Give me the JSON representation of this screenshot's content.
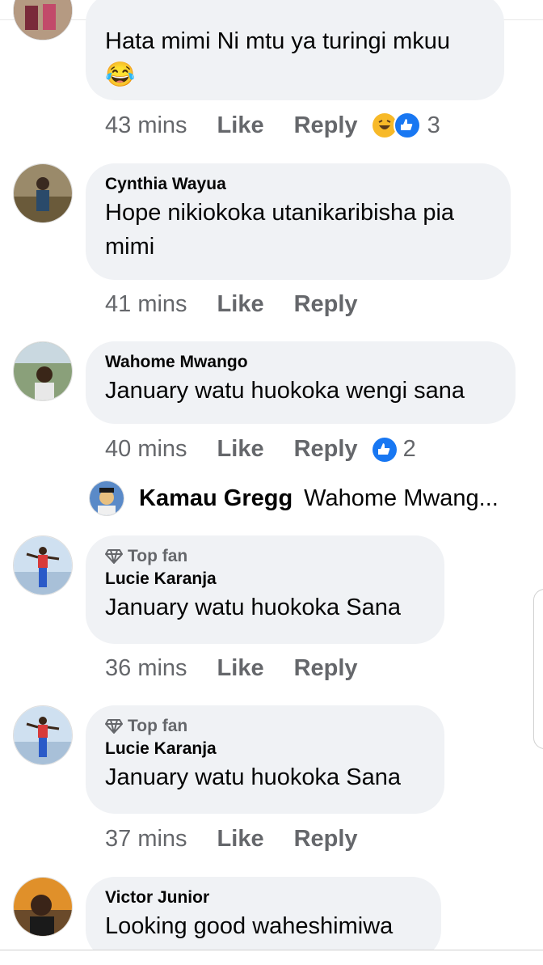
{
  "comments": [
    {
      "name": "",
      "text": "Hata mimi Ni mtu ya turingi mkuu",
      "emoji": "😂",
      "time": "43 mins",
      "like": "Like",
      "reply": "Reply",
      "reactions": "3"
    },
    {
      "name": "Cynthia Wayua",
      "text": "Hope nikiokoka  utanikaribisha pia mimi",
      "time": "41 mins",
      "like": "Like",
      "reply": "Reply"
    },
    {
      "name": "Wahome Mwango",
      "text": "January watu huokoka wengi sana",
      "time": "40 mins",
      "like": "Like",
      "reply": "Reply",
      "reactions": "2"
    },
    {
      "badge": "Top fan",
      "name": "Lucie Karanja",
      "text": "January watu huokoka Sana",
      "time": "36 mins",
      "like": "Like",
      "reply": "Reply"
    },
    {
      "badge": "Top fan",
      "name": "Lucie Karanja",
      "text": "January watu huokoka Sana",
      "time": "37 mins",
      "like": "Like",
      "reply": "Reply"
    },
    {
      "name": "Victor Junior",
      "text": "Looking good waheshimiwa"
    }
  ],
  "reply_preview": {
    "name": "Kamau Gregg",
    "text": "Wahome Mwang..."
  },
  "colors": {
    "bubble": "#f0f2f5",
    "like_blue": "#1877f2",
    "haha_yellow": "#f7b928",
    "meta_gray": "#65676b"
  }
}
